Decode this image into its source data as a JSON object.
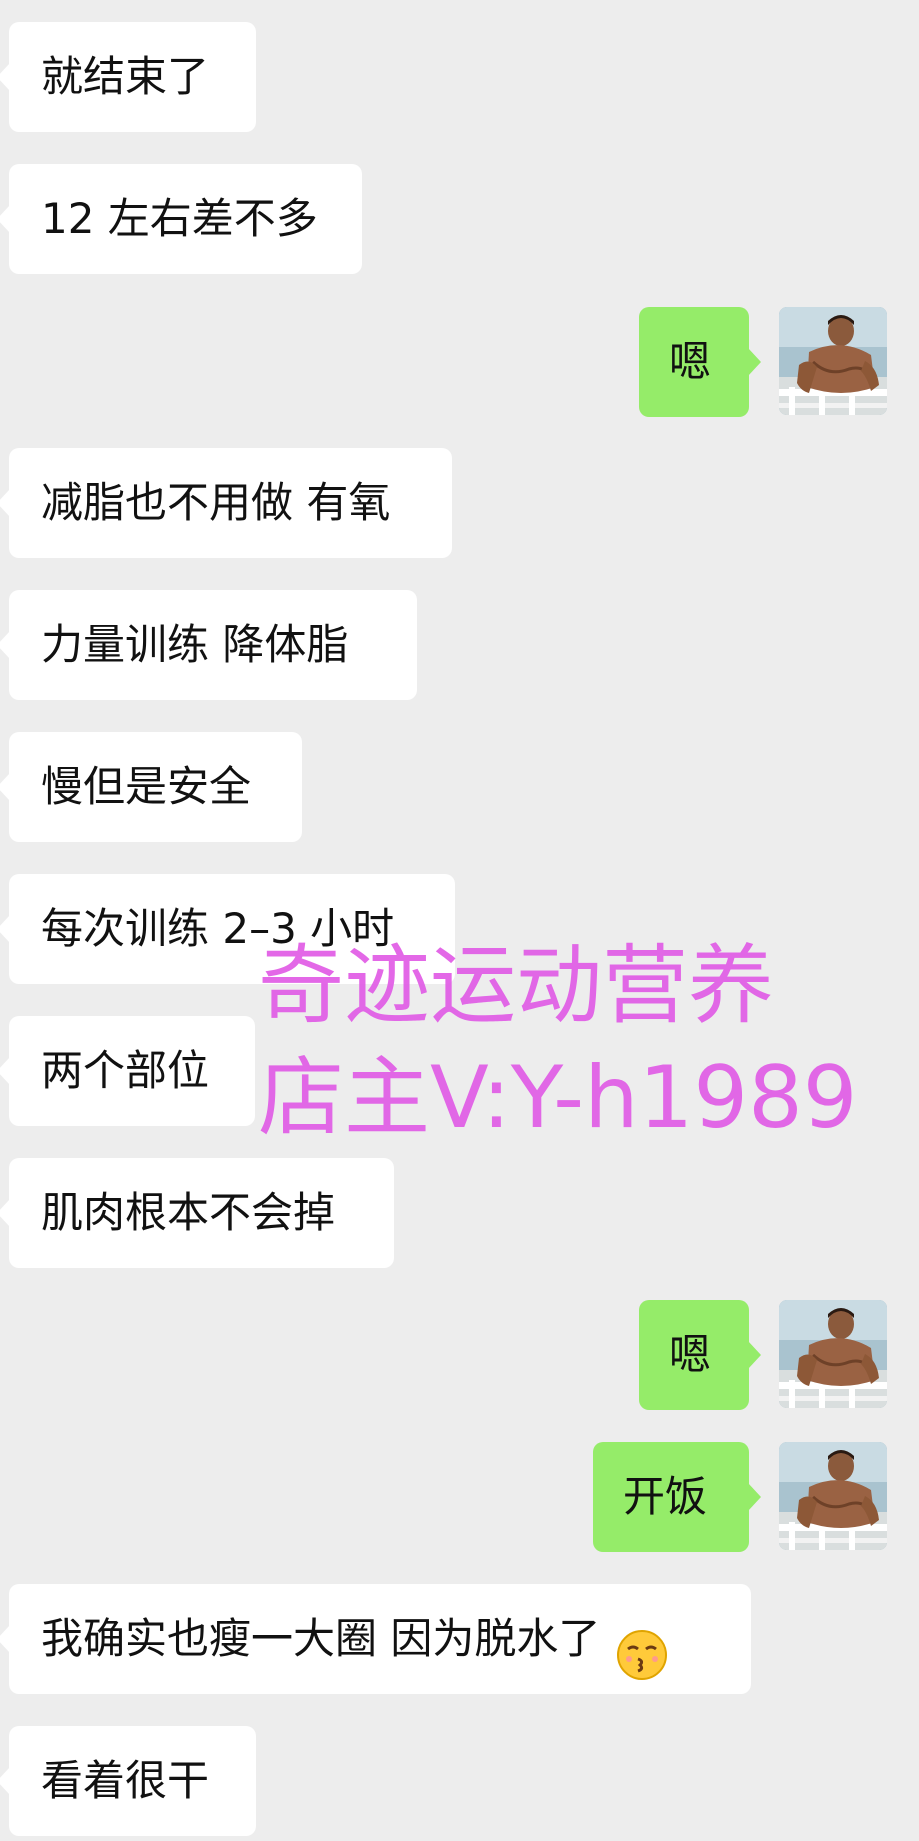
{
  "colors": {
    "background": "#ededed",
    "incoming_bubble": "#ffffff",
    "outgoing_bubble": "#95ec69",
    "watermark": "#e15ce6"
  },
  "messages": [
    {
      "side": "in",
      "text": "就结束了"
    },
    {
      "side": "in",
      "text": "12 左右差不多"
    },
    {
      "side": "out",
      "text": "嗯",
      "avatar_icon": "user-avatar-photo"
    },
    {
      "side": "in",
      "text": "减脂也不用做 有氧"
    },
    {
      "side": "in",
      "text": "力量训练  降体脂"
    },
    {
      "side": "in",
      "text": "慢但是安全"
    },
    {
      "side": "in",
      "text": "每次训练 2–3 小时"
    },
    {
      "side": "in",
      "text": "两个部位"
    },
    {
      "side": "in",
      "text": "肌肉根本不会掉"
    },
    {
      "side": "out",
      "text": "嗯",
      "avatar_icon": "user-avatar-photo"
    },
    {
      "side": "out",
      "text": "开饭",
      "avatar_icon": "user-avatar-photo"
    },
    {
      "side": "in",
      "text": "我确实也瘦一大圈  因为脱水了",
      "emoji": "kissing-face-emoji"
    },
    {
      "side": "in",
      "text": "看着很干"
    }
  ],
  "watermark": {
    "line1": "奇迹运动营养",
    "line2": "店主V:Y-h1989"
  }
}
